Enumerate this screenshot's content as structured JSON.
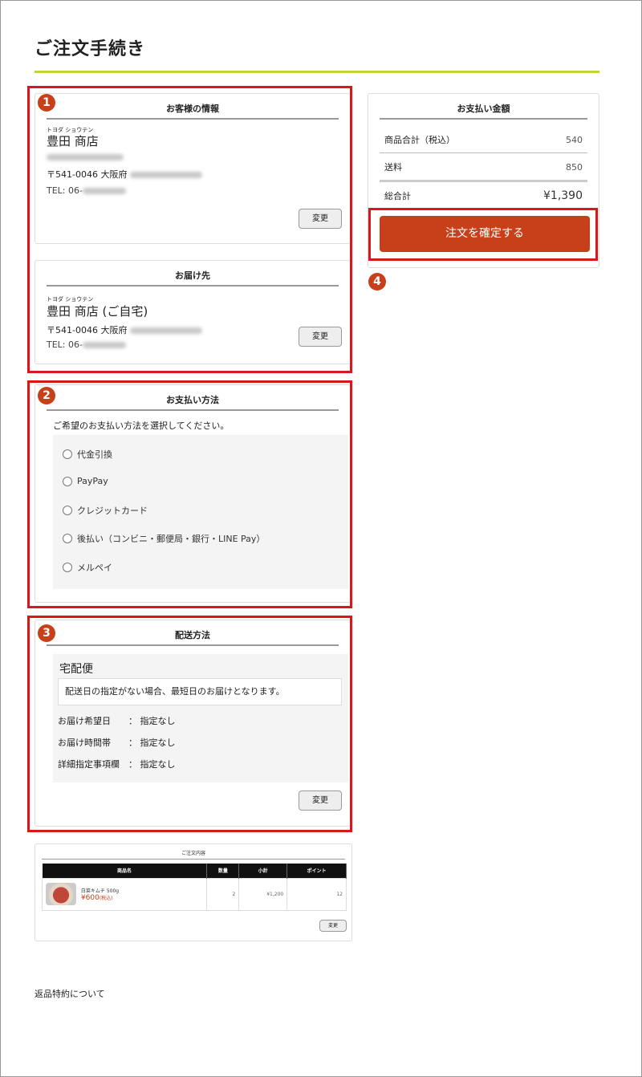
{
  "page": {
    "title": "ご注文手続き"
  },
  "badges": [
    "1",
    "2",
    "3",
    "4"
  ],
  "customer": {
    "heading": "お客様の情報",
    "ruby": "トヨダ ショウテン",
    "name": "豊田 商店",
    "postal": "〒541-0046 大阪府",
    "tel_prefix": "TEL: 06-",
    "change": "変更"
  },
  "delivery_address": {
    "heading": "お届け先",
    "ruby": "トヨダ ショウテン",
    "name": "豊田 商店 (ご自宅)",
    "postal": "〒541-0046 大阪府",
    "tel_prefix": "TEL: 06-",
    "change": "変更"
  },
  "payment_method": {
    "heading": "お支払い方法",
    "description": "ご希望のお支払い方法を選択してください。",
    "options": [
      "代金引換",
      "PayPay",
      "クレジットカード",
      "後払い（コンビニ・郵便局・銀行・LINE Pay）",
      "メルペイ"
    ]
  },
  "shipping": {
    "heading": "配送方法",
    "method": "宅配便",
    "note": "配送日の指定がない場合、最短日のお届けとなります。",
    "rows": [
      {
        "label": "お届け希望日",
        "sep": "：",
        "value": "指定なし"
      },
      {
        "label": "お届け時間帯",
        "sep": "：",
        "value": "指定なし"
      },
      {
        "label": "詳細指定事項欄",
        "sep": "：",
        "value": "指定なし"
      }
    ],
    "change": "変更"
  },
  "order_items": {
    "heading": "ご注文内容",
    "columns": [
      "商品名",
      "数量",
      "小計",
      "ポイント"
    ],
    "rows": [
      {
        "name": "白菜キムチ 500g",
        "price": "¥600",
        "tax": "(税込)",
        "qty": "2",
        "subtotal": "¥1,200",
        "points": "12"
      }
    ],
    "change": "変更"
  },
  "summary": {
    "heading": "お支払い金額",
    "rows": [
      {
        "label": "商品合計（税込）",
        "value": "540"
      },
      {
        "label": "送料",
        "value": "850"
      }
    ],
    "total_label": "総合計",
    "total_value": "¥1,390",
    "confirm": "注文を確定する"
  },
  "footer": {
    "returns_link": "返品特約について"
  },
  "colors": {
    "accent_line": "#c3d43a",
    "primary": "#c8401a",
    "highlight": "#d9161c"
  }
}
